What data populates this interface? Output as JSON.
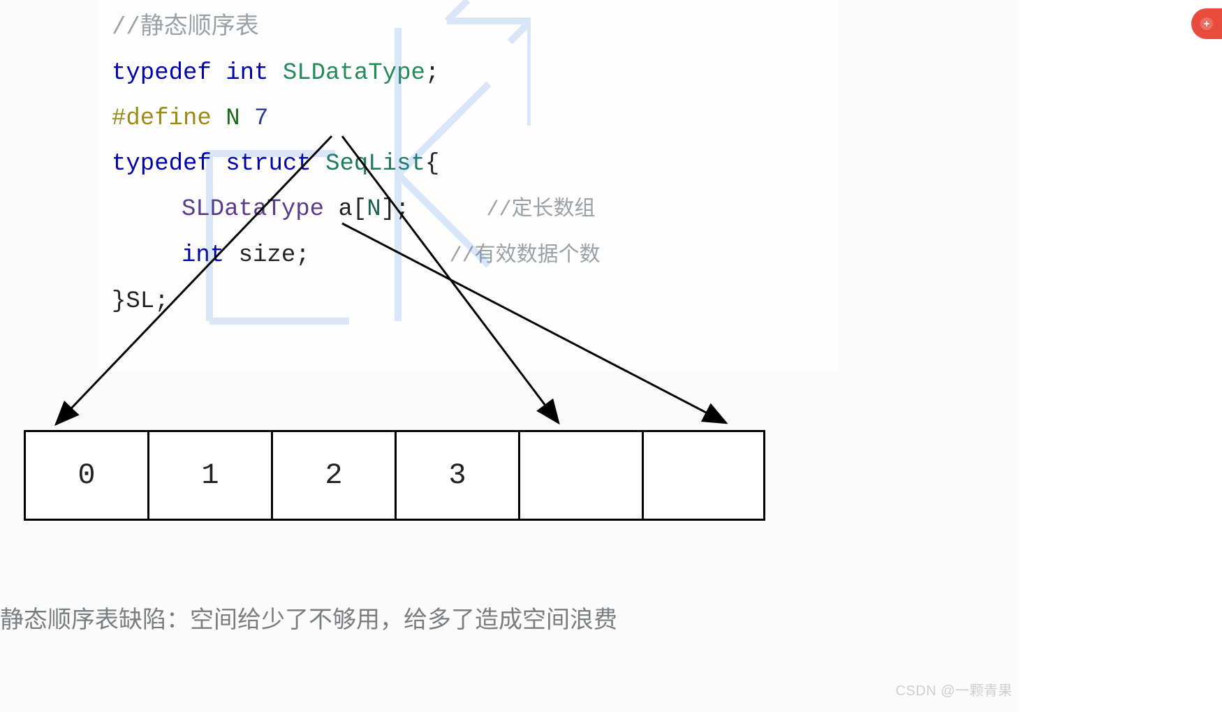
{
  "code": {
    "comment1": "//静态顺序表",
    "typedef1_kw": "typedef ",
    "typedef1_int": "int ",
    "typedef1_type": "SLDataType",
    "typedef1_semi": ";",
    "define_kw": "#define ",
    "define_macro": "N ",
    "define_val": "7",
    "typedef2_kw": "typedef ",
    "typedef2_struct_kw": "struct ",
    "typedef2_name": "SeqList",
    "typedef2_brace": "{",
    "field1_type": "SLDataType ",
    "field1_name": "a",
    "field1_bracket_open": "[",
    "field1_idx": "N",
    "field1_bracket_close": "]",
    "field1_semi": ";",
    "field1_comment": "//定长数组",
    "field2_type": "int ",
    "field2_name": "size",
    "field2_semi": ";",
    "field2_comment": "//有效数据个数",
    "close_brace": "}",
    "close_name": "SL",
    "close_semi": ";"
  },
  "array_cells": [
    "0",
    "1",
    "2",
    "3",
    "",
    ""
  ],
  "caption": "静态顺序表缺陷：空间给少了不够用，给多了造成空间浪费",
  "watermark": "CSDN @一颗青果"
}
